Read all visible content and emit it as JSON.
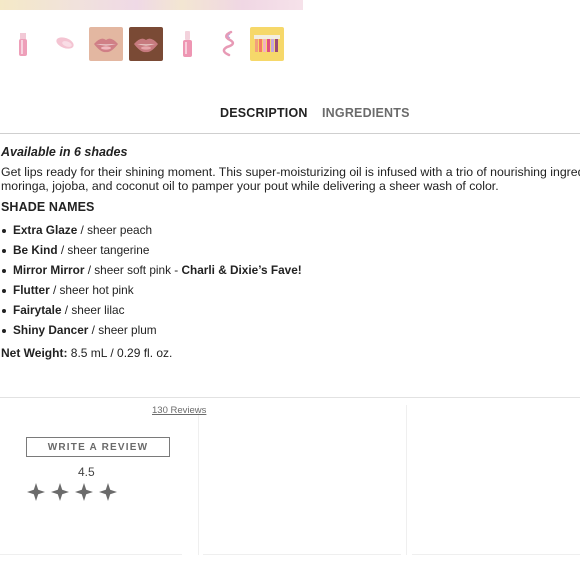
{
  "gallery": {
    "thumbnails": [
      {
        "icon": "lip-oil-tube-icon"
      },
      {
        "icon": "lip-oil-swatch-icon"
      },
      {
        "icon": "lips-light-icon"
      },
      {
        "icon": "lips-deep-icon"
      },
      {
        "icon": "lip-oil-bottle-icon"
      },
      {
        "icon": "lip-oil-swirl-icon"
      },
      {
        "icon": "shade-lineup-icon"
      }
    ]
  },
  "tabs": {
    "description": "DESCRIPTION",
    "ingredients": "INGREDIENTS"
  },
  "description": {
    "availability": "Available in 6 shades",
    "intro_line1": "Get lips ready for their shining moment. This super-moisturizing oil is infused with a trio of nourishing ingredie",
    "intro_line2": "moringa, jojoba, and coconut oil to pamper your pout while delivering a sheer wash of color.",
    "shade_heading": "SHADE NAMES",
    "shades": [
      {
        "name": "Extra Glaze",
        "desc": " / sheer peach",
        "extra": ""
      },
      {
        "name": "Be Kind",
        "desc": " / sheer tangerine",
        "extra": ""
      },
      {
        "name": "Mirror Mirror",
        "desc": " / sheer soft pink - ",
        "extra": "Charli & Dixie’s Fave!"
      },
      {
        "name": "Flutter",
        "desc": " / sheer hot pink",
        "extra": ""
      },
      {
        "name": "Fairytale",
        "desc": " / sheer lilac",
        "extra": ""
      },
      {
        "name": "Shiny Dancer",
        "desc": " / sheer plum",
        "extra": ""
      }
    ],
    "net_weight_label": "Net Weight:",
    "net_weight_value": " 8.5 mL / 0.29 fl. oz."
  },
  "reviews": {
    "count_text": "130 Reviews",
    "write_button": "WRITE A REVIEW",
    "rating": "4.5",
    "visible_stars": 4,
    "star_color": "#6b6b6b"
  }
}
